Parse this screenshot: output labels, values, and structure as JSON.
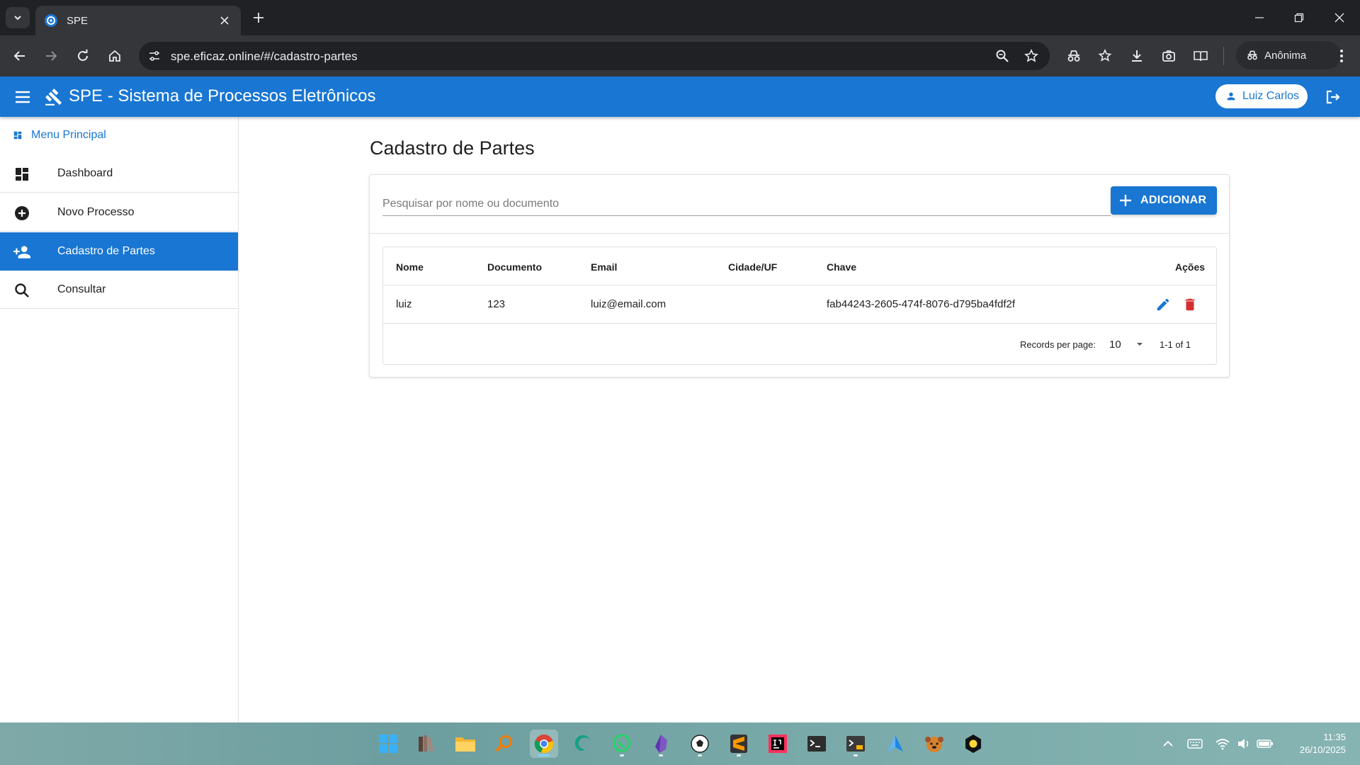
{
  "browser": {
    "tab_title": "SPE",
    "url": "spe.eficaz.online/#/cadastro-partes",
    "incognito_label": "Anônima"
  },
  "header": {
    "title": "SPE - Sistema de Processos Eletrônicos",
    "user_name": "Luiz Carlos"
  },
  "sidebar": {
    "menu_title": "Menu Principal",
    "items": [
      {
        "label": "Dashboard",
        "icon": "dashboard-icon"
      },
      {
        "label": "Novo Processo",
        "icon": "add-circle-icon"
      },
      {
        "label": "Cadastro de Partes",
        "icon": "person-add-icon",
        "active": true
      },
      {
        "label": "Consultar",
        "icon": "search-icon"
      }
    ]
  },
  "main": {
    "title": "Cadastro de Partes",
    "search_placeholder": "Pesquisar por nome ou documento",
    "search_value": "",
    "add_label": "ADICIONAR",
    "table": {
      "columns": [
        "Nome",
        "Documento",
        "Email",
        "Cidade/UF",
        "Chave",
        "Ações"
      ],
      "rows": [
        {
          "nome": "luiz",
          "documento": "123",
          "email": "luiz@email.com",
          "cidade_uf": "",
          "chave": "fab44243-2605-474f-8076-d795ba4fdf2f"
        }
      ]
    },
    "pagination": {
      "label": "Records per page:",
      "per_page": "10",
      "info": "1-1 of 1"
    }
  },
  "colors": {
    "primary": "#1976d2",
    "delete": "#d32f2f",
    "chrome_dark": "#202124",
    "chrome_toolbar": "#35363a"
  },
  "taskbar": {
    "time": "11:35",
    "date": "26/10/2025"
  }
}
